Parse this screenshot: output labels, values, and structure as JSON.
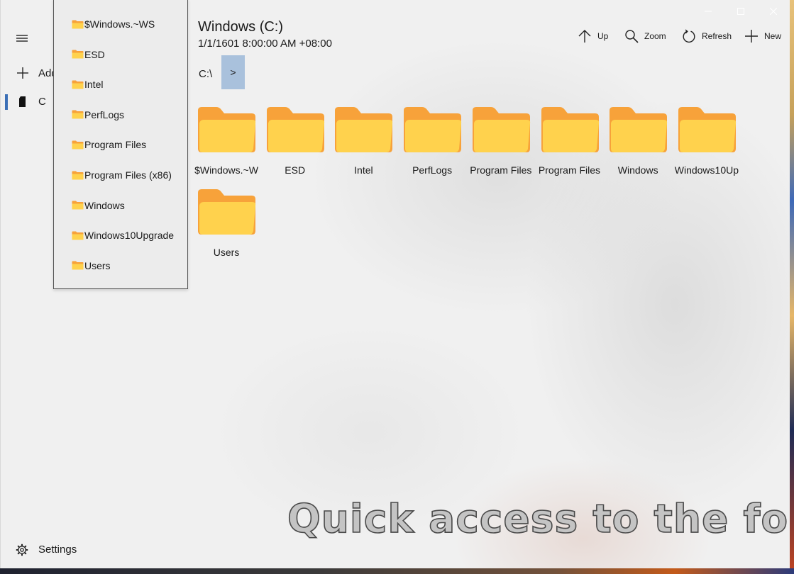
{
  "nav": {
    "add_label": "Add",
    "drive_label": "C",
    "settings_label": "Settings"
  },
  "flyout": {
    "items": [
      {
        "label": "$Windows.~WS"
      },
      {
        "label": "ESD"
      },
      {
        "label": "Intel"
      },
      {
        "label": "PerfLogs"
      },
      {
        "label": "Program Files"
      },
      {
        "label": "Program Files (x86)"
      },
      {
        "label": "Windows"
      },
      {
        "label": "Windows10Upgrade"
      },
      {
        "label": "Users"
      }
    ]
  },
  "header": {
    "title": "Windows (C:)",
    "subtitle": "1/1/1601 8:00:00 AM +08:00"
  },
  "toolbar": {
    "up_label": "Up",
    "zoom_label": "Zoom",
    "refresh_label": "Refresh",
    "new_label": "New"
  },
  "breadcrumb": {
    "root": "C:\\",
    "separator": ">"
  },
  "folders": [
    {
      "label": "$Windows.~W"
    },
    {
      "label": "ESD"
    },
    {
      "label": "Intel"
    },
    {
      "label": "PerfLogs"
    },
    {
      "label": "Program Files"
    },
    {
      "label": "Program Files"
    },
    {
      "label": "Windows"
    },
    {
      "label": "Windows10Up"
    },
    {
      "label": "Users"
    }
  ],
  "overlay_caption": "Quick access to the folder",
  "colors": {
    "accent": "#3b6fb6",
    "breadcrumb_highlight": "#a9c1dc",
    "folder_back": "#f7a23a",
    "folder_front": "#ffd24d"
  },
  "icons": [
    "hamburger-icon",
    "plus-icon",
    "drive-icon",
    "gear-icon",
    "folder-icon",
    "arrow-up-icon",
    "search-icon",
    "refresh-icon",
    "minimize-icon",
    "maximize-icon",
    "close-icon"
  ]
}
